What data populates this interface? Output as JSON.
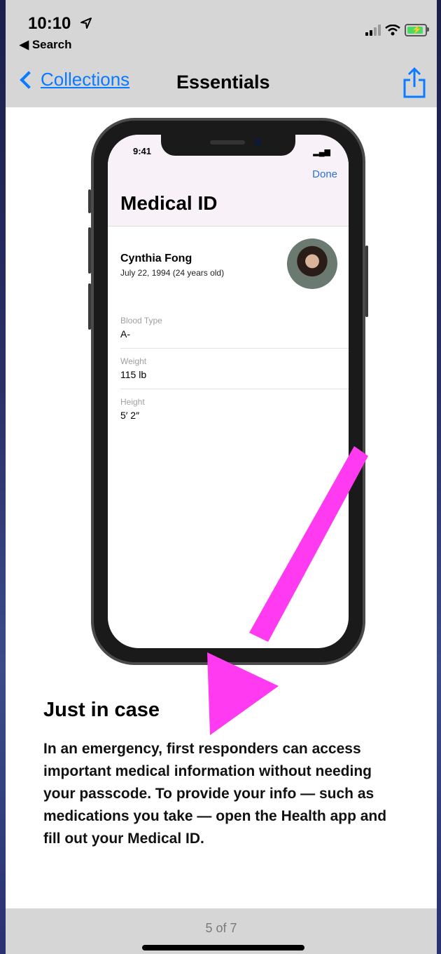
{
  "status_bar": {
    "time": "10:10",
    "back_app": "Search"
  },
  "nav": {
    "back_label": "Collections",
    "title": "Essentials"
  },
  "mockup": {
    "status_time": "9:41",
    "done_label": "Done",
    "title": "Medical ID",
    "name": "Cynthia Fong",
    "dob": "July 22, 1994 (24 years old)",
    "fields": [
      {
        "label": "Blood Type",
        "value": "A-"
      },
      {
        "label": "Weight",
        "value": "115 lb"
      },
      {
        "label": "Height",
        "value": "5′ 2″"
      }
    ]
  },
  "content": {
    "heading": "Just in case",
    "body": "In an emergency, first responders can access important medical information without needing your passcode. To provide your info — such as medications you take — open the Health app and fill out your Medical ID."
  },
  "pager": {
    "label": "5 of 7"
  },
  "colors": {
    "accent": "#0a7aff",
    "arrow": "#ff3af0",
    "battery": "#4cd964"
  },
  "icons": [
    "location-arrow-icon",
    "back-triangle-icon",
    "signal-icon",
    "wifi-icon",
    "battery-icon",
    "chevron-left-icon",
    "share-icon"
  ]
}
